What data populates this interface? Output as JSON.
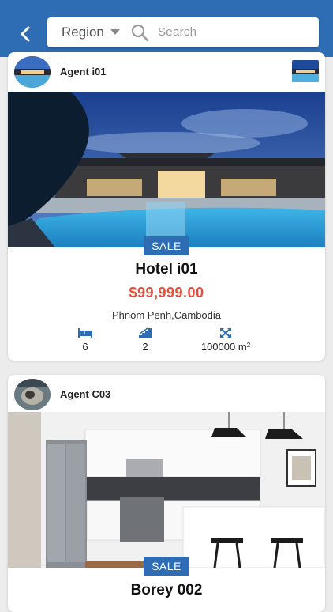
{
  "header": {
    "back_icon": "chevron-left-icon",
    "region_label": "Region",
    "search_placeholder": "Search",
    "color": "#2e6db4"
  },
  "listings": [
    {
      "agent": "Agent i01",
      "tag": "SALE",
      "title": "Hotel i01",
      "price": "$99,999.00",
      "location": "Phnom Penh,Cambodia",
      "bedrooms": "6",
      "floors": "2",
      "area": "100000",
      "area_unit": "m",
      "area_exp": "2"
    },
    {
      "agent": "Agent C03",
      "tag": "SALE",
      "title": "Borey 002"
    }
  ],
  "colors": {
    "accent": "#2e6db4",
    "price": "#e74c3c"
  }
}
